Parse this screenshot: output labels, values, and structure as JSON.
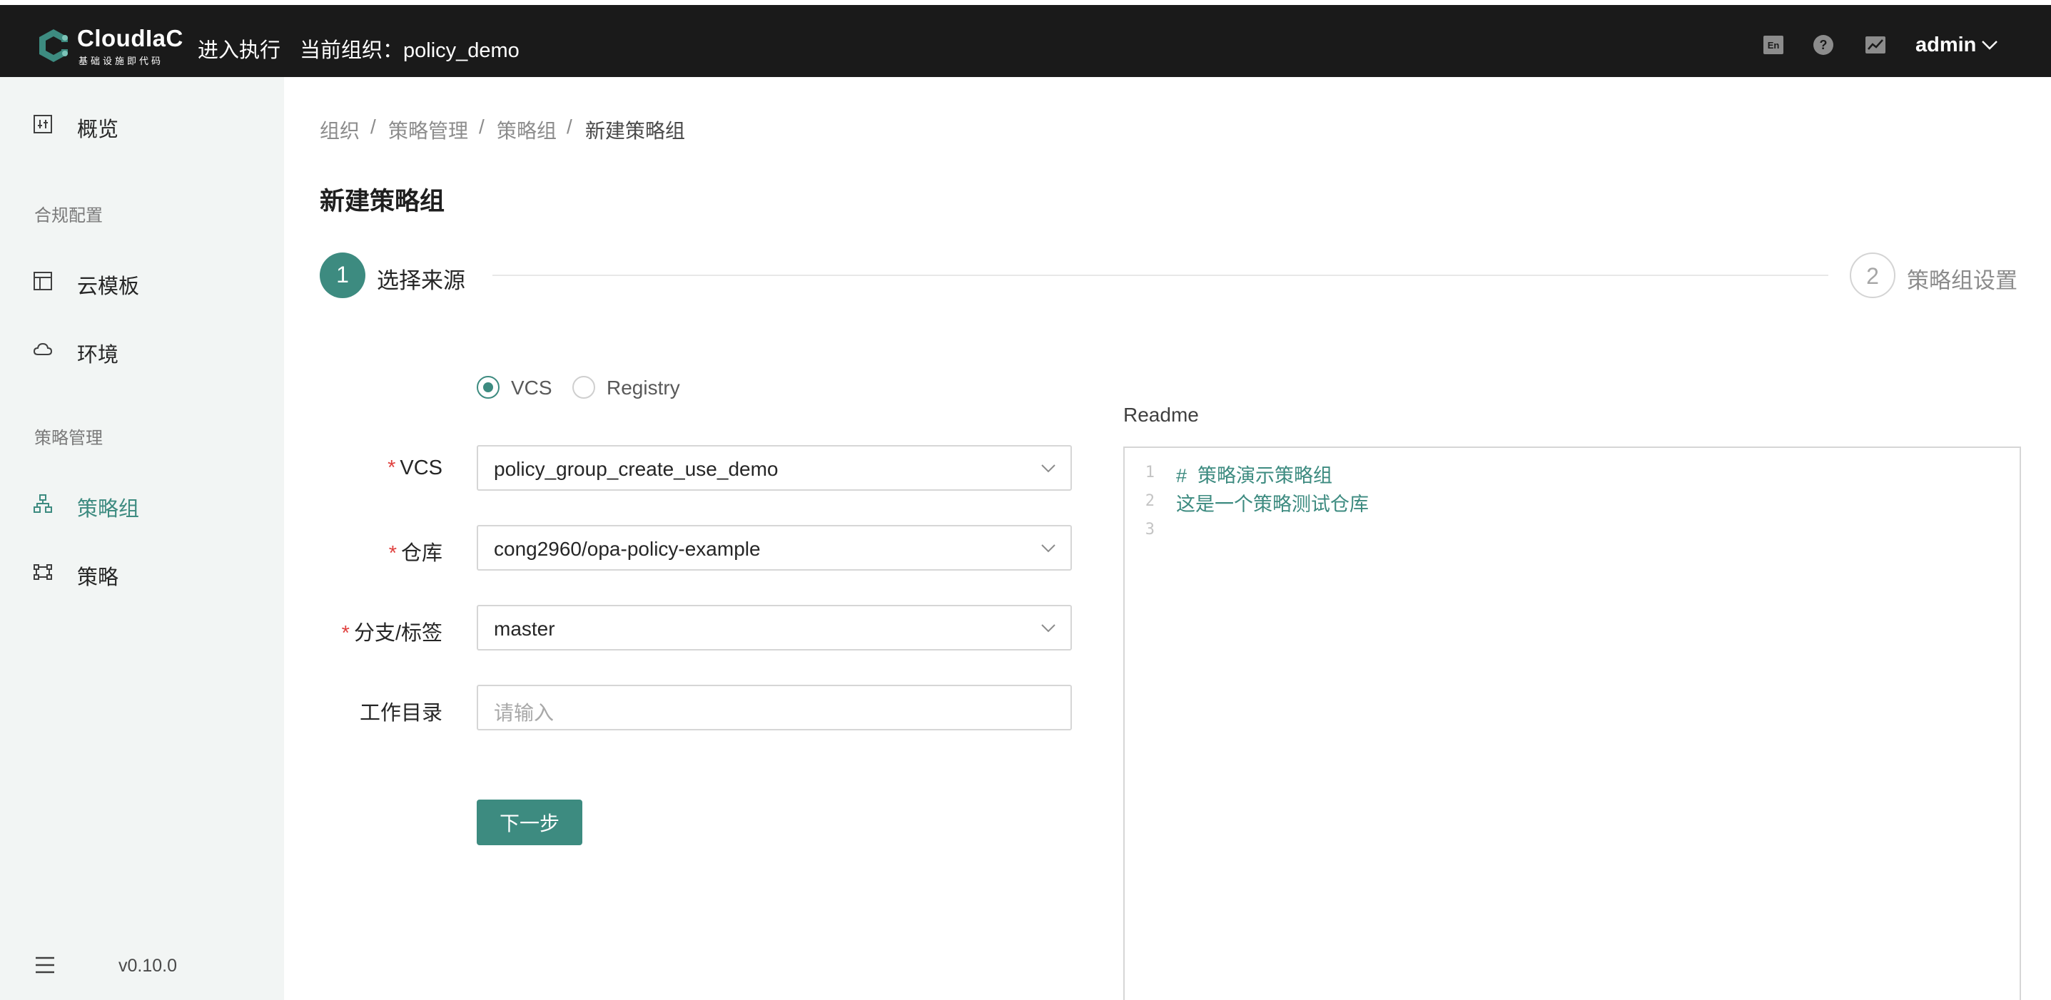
{
  "header": {
    "brand_name": "CloudIaC",
    "brand_tagline": "基础设施即代码",
    "enter_exec": "进入执行",
    "current_org": "当前组织：policy_demo",
    "lang_icon": "en-lang-icon",
    "help_icon": "question-circle-icon",
    "stats_icon": "line-chart-icon",
    "user": "admin"
  },
  "sidebar": {
    "overview": "概览",
    "group_compliance": "合规配置",
    "templates": "云模板",
    "environments": "环境",
    "group_policy": "策略管理",
    "policy_groups": "策略组",
    "policies": "策略",
    "version": "v0.10.0"
  },
  "breadcrumb": [
    "组织",
    "策略管理",
    "策略组",
    "新建策略组"
  ],
  "page_title": "新建策略组",
  "steps": [
    {
      "number": "1",
      "label": "选择来源"
    },
    {
      "number": "2",
      "label": "策略组设置"
    }
  ],
  "source_type": {
    "options": [
      "VCS",
      "Registry"
    ],
    "selected": "VCS"
  },
  "form": {
    "vcs_label": "VCS",
    "vcs_value": "policy_group_create_use_demo",
    "repo_label": "仓库",
    "repo_value": "cong2960/opa-policy-example",
    "branch_label": "分支/标签",
    "branch_value": "master",
    "workdir_label": "工作目录",
    "workdir_placeholder": "请输入",
    "next_button": "下一步"
  },
  "readme": {
    "title": "Readme",
    "lines": [
      {
        "n": "1",
        "text": "#  策略演示策略组"
      },
      {
        "n": "2",
        "text": "这是一个策略测试仓库"
      },
      {
        "n": "3",
        "text": ""
      }
    ]
  },
  "colors": {
    "primary": "#3d8b80",
    "header_bg": "#1a1a1a",
    "sidebar_bg": "#f2f5f4",
    "required": "#e0413f"
  }
}
